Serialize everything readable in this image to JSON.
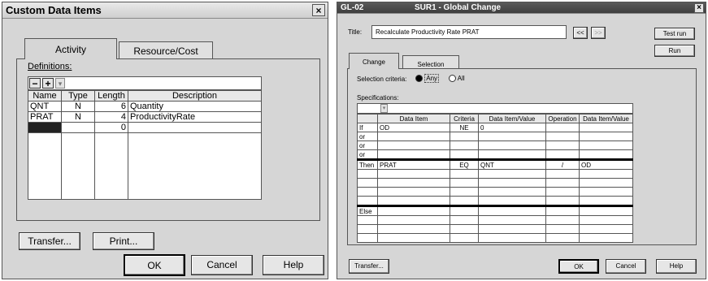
{
  "left": {
    "title": "Custom Data Items",
    "close": "×",
    "tabs": [
      "Activity",
      "Resource/Cost"
    ],
    "definitions_label": "Definitions:",
    "toolbar": {
      "minus": "−",
      "plus": "+",
      "dropdown": "▾"
    },
    "columns": [
      "Name",
      "Type",
      "Length",
      "Description"
    ],
    "rows": [
      [
        "QNT",
        "N",
        "6",
        "Quantity"
      ],
      [
        "PRAT",
        "N",
        "4",
        "ProductivityRate"
      ],
      [
        "",
        "",
        "0",
        ""
      ]
    ],
    "transfer_label": "Transfer...",
    "print_label": "Print...",
    "ok_label": "OK",
    "cancel_label": "Cancel",
    "help_label": "Help"
  },
  "right": {
    "code": "GL-02",
    "title": "SUR1 - Global Change",
    "close": "×",
    "title_label": "Title:",
    "title_value": "Recalculate Productivity Rate PRAT",
    "nav_prev": "<<",
    "nav_next": ">>",
    "test_run": "Test run",
    "run": "Run",
    "tabs": [
      "Change",
      "Selection"
    ],
    "selection_criteria_label": "Selection criteria:",
    "option_any": "Any",
    "option_all": "All",
    "specifications_label": "Specifications:",
    "dropdown": "▾",
    "columns": [
      "",
      "Data Item",
      "Criteria",
      "Data Item/Value",
      "Operation",
      "Data Item/Value"
    ],
    "if_rows": [
      [
        "If",
        "OD",
        "NE",
        "0",
        "",
        ""
      ],
      [
        "or",
        "",
        "",
        "",
        "",
        ""
      ],
      [
        "or",
        "",
        "",
        "",
        "",
        ""
      ],
      [
        "or",
        "",
        "",
        "",
        "",
        ""
      ]
    ],
    "then_rows": [
      [
        "Then",
        "PRAT",
        "EQ",
        "QNT",
        "/",
        "OD"
      ],
      [
        "",
        "",
        "",
        "",
        "",
        ""
      ],
      [
        "",
        "",
        "",
        "",
        "",
        ""
      ],
      [
        "",
        "",
        "",
        "",
        "",
        ""
      ],
      [
        "",
        "",
        "",
        "",
        "",
        ""
      ]
    ],
    "else_rows": [
      [
        "Else",
        "",
        "",
        "",
        "",
        ""
      ],
      [
        "",
        "",
        "",
        "",
        "",
        ""
      ],
      [
        "",
        "",
        "",
        "",
        "",
        ""
      ],
      [
        "",
        "",
        "",
        "",
        "",
        ""
      ]
    ],
    "transfer_label": "Transfer...",
    "ok_label": "OK",
    "cancel_label": "Cancel",
    "help_label": "Help"
  }
}
